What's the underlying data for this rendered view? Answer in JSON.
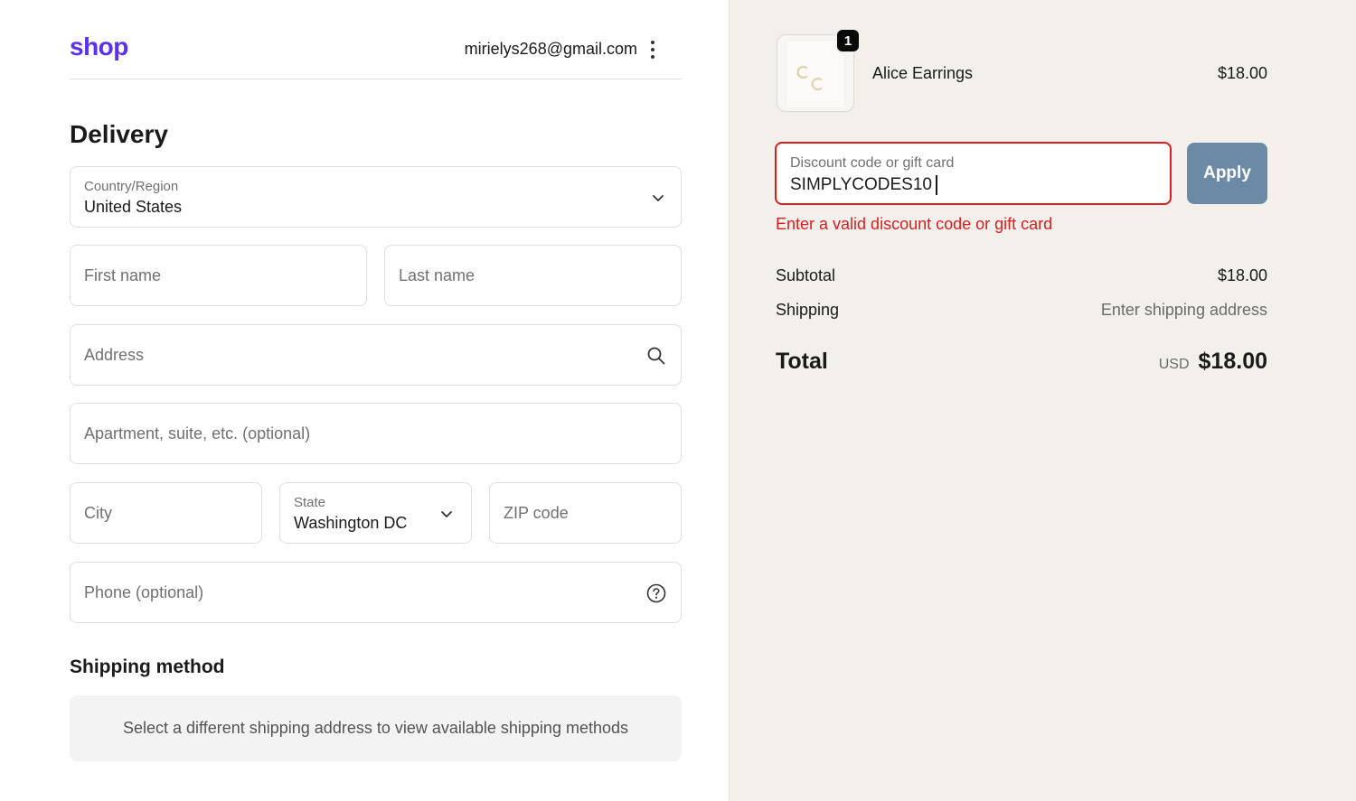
{
  "header": {
    "logo": "shop",
    "account_email": "mirielys268@gmail.com"
  },
  "delivery": {
    "title": "Delivery",
    "country": {
      "label": "Country/Region",
      "value": "United States"
    },
    "first_name": {
      "placeholder": "First name"
    },
    "last_name": {
      "placeholder": "Last name"
    },
    "address": {
      "placeholder": "Address"
    },
    "apartment": {
      "placeholder": "Apartment, suite, etc. (optional)"
    },
    "city": {
      "placeholder": "City"
    },
    "state": {
      "label": "State",
      "value": "Washington DC"
    },
    "zip": {
      "placeholder": "ZIP code"
    },
    "phone": {
      "placeholder": "Phone (optional)"
    }
  },
  "shipping_method": {
    "title": "Shipping method",
    "message": "Select a different shipping address to view available shipping methods"
  },
  "order": {
    "item": {
      "name": "Alice Earrings",
      "price": "$18.00",
      "quantity": "1"
    },
    "discount": {
      "label": "Discount code or gift card",
      "value": "SIMPLYCODES10",
      "apply_label": "Apply",
      "error": "Enter a valid discount code or gift card"
    },
    "subtotal": {
      "label": "Subtotal",
      "value": "$18.00"
    },
    "shipping": {
      "label": "Shipping",
      "value": "Enter shipping address"
    },
    "total": {
      "label": "Total",
      "currency": "USD",
      "value": "$18.00"
    }
  },
  "colors": {
    "brand": "#5a31f4",
    "error": "#dd1d1d",
    "apply_button": "#6b8aa6",
    "summary_background": "#f3f0eb"
  },
  "icons": {
    "menu": "kebab-menu-icon",
    "dropdown": "chevron-down-icon",
    "search": "search-icon",
    "help": "question-circle-icon"
  }
}
